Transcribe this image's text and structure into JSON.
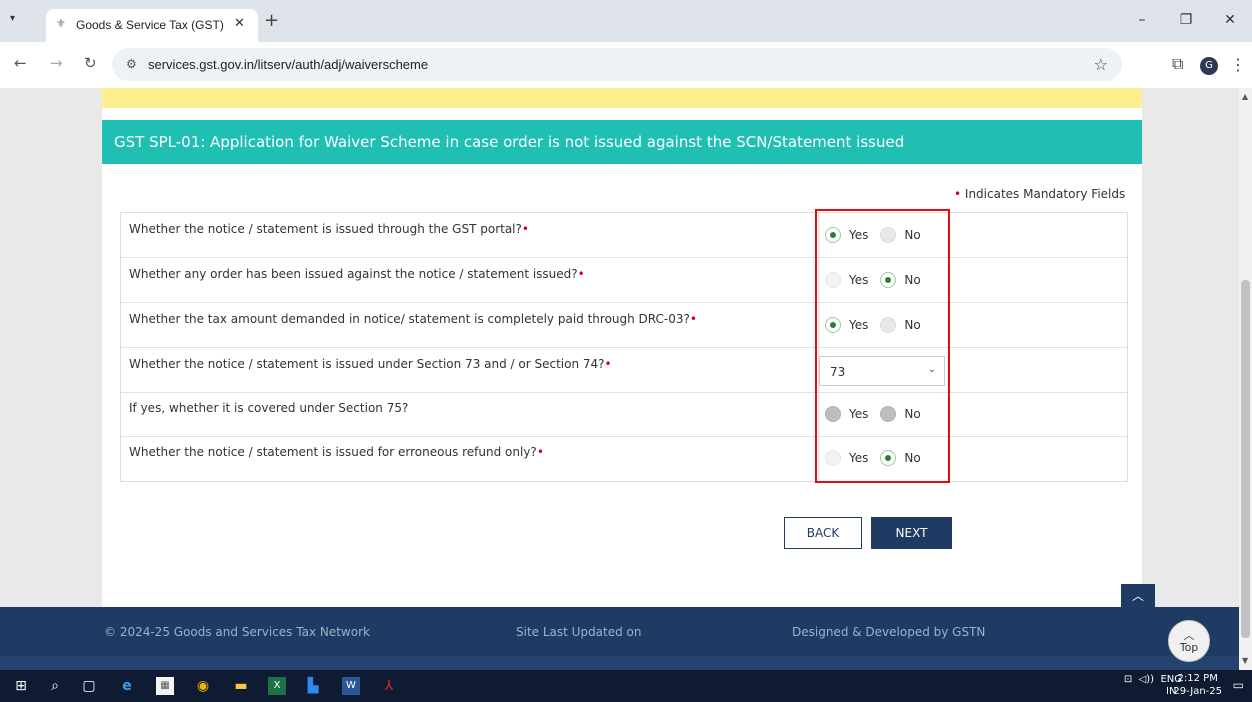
{
  "browser": {
    "tab_title": "Goods & Service Tax (GST) | Use",
    "url": "services.gst.gov.in/litserv/auth/adj/waiverscheme",
    "avatar_letter": "G"
  },
  "form": {
    "title": "GST SPL-01: Application for Waiver Scheme in case order is not issued against the SCN/Statement issued",
    "mandatory_note": "Indicates Mandatory Fields",
    "questions": [
      {
        "text": "Whether the notice / statement is issued through the GST portal?",
        "required": true,
        "type": "radio",
        "yes": "Yes",
        "no": "No",
        "selected": "Yes"
      },
      {
        "text": "Whether any order has been issued against the notice / statement issued?",
        "required": true,
        "type": "radio",
        "yes": "Yes",
        "no": "No",
        "selected": "No"
      },
      {
        "text": "Whether the tax amount demanded in notice/ statement is completely paid through DRC-03?",
        "required": true,
        "type": "radio",
        "yes": "Yes",
        "no": "No",
        "selected": "Yes"
      },
      {
        "text": "Whether the notice / statement is issued under Section 73 and / or Section 74?",
        "required": true,
        "type": "select",
        "value": "73"
      },
      {
        "text": "If yes, whether it is covered under Section 75?",
        "required": false,
        "type": "radio",
        "yes": "Yes",
        "no": "No",
        "selected": "disabled"
      },
      {
        "text": "Whether the notice / statement is issued for erroneous refund only?",
        "required": true,
        "type": "radio",
        "yes": "Yes",
        "no": "No",
        "selected": "No"
      }
    ],
    "back_label": "BACK",
    "next_label": "NEXT"
  },
  "footer": {
    "copyright": "© 2024-25 Goods and Services Tax Network",
    "updated": "Site Last Updated on",
    "designed": "Designed & Developed by GSTN",
    "top_label": "Top"
  },
  "taskbar": {
    "lang": "ENG",
    "region": "IN",
    "time": "2:12 PM",
    "date": "29-Jan-25"
  },
  "colors": {
    "header_teal": "#1fbfb3",
    "navy": "#1f3a63",
    "highlight_red": "#e30d0d",
    "radio_green": "#2e7d32"
  }
}
